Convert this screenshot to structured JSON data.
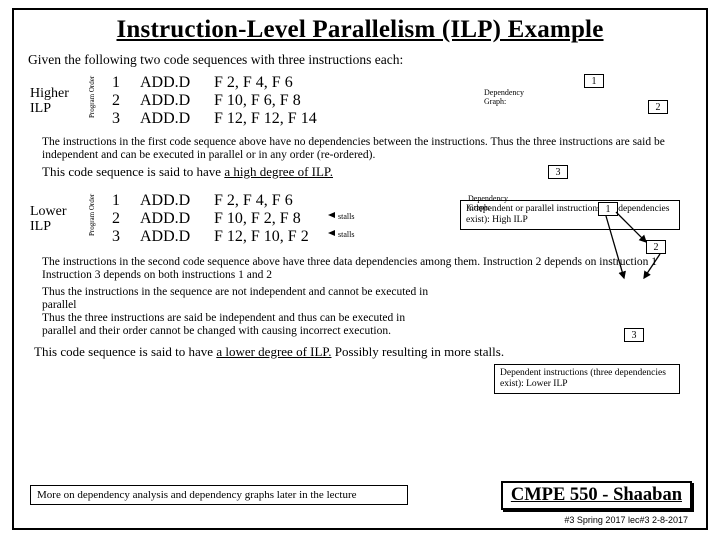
{
  "title": "Instruction-Level Parallelism (ILP) Example",
  "intro": "Given the following two code sequences with three instructions each:",
  "labels": {
    "higher": "Higher\nILP",
    "lower": "Lower\nILP",
    "program_order": "Program  Order",
    "dep_graph": "Dependency\nGraph:",
    "stalls": "stalls"
  },
  "nodes": {
    "n1": "1",
    "n2": "2",
    "n3": "3"
  },
  "seq1": {
    "r1": {
      "n": "1",
      "op": "ADD.D",
      "args": "F 2, F 4, F 6"
    },
    "r2": {
      "n": "2",
      "op": "ADD.D",
      "args": "F 10, F 6, F 8"
    },
    "r3": {
      "n": "3",
      "op": "ADD.D",
      "args": "F 12, F 12, F 14"
    }
  },
  "seq2": {
    "r1": {
      "n": "1",
      "op": "ADD.D",
      "args": "F 2, F 4, F 6"
    },
    "r2": {
      "n": "2",
      "op": "ADD.D",
      "args": "F 10, F 2, F 8"
    },
    "r3": {
      "n": "3",
      "op": "ADD.D",
      "args": "F 12, F 10, F 2"
    }
  },
  "para1": "The instructions in the first code sequence above have no dependencies  between the instructions. Thus the three instructions are said be independent and can be executed in parallel or in any order (re-ordered).",
  "hi1a": "This code sequence is said to have ",
  "hi1b": "a high degree of ILP.",
  "box1": "Independent or parallel instructions  (no dependencies exist):  High ILP",
  "para2": "The instructions in the second code sequence above have three data dependencies among them. Instruction 2 depends on instruction 1\nInstruction 3 depends on both  instructions  1 and 2",
  "para3": "Thus the instructions in the sequence are not independent and cannot be executed in parallel\nThus the three instructions are said be independent and thus can be executed in parallel and their order cannot be changed with causing incorrect execution.",
  "box2": "Dependent instructions (three dependencies exist):  Lower ILP",
  "hi2a": "This code sequence is said to have ",
  "hi2b": "a lower degree of ILP.",
  "hi2c": " Possibly resulting in more stalls.",
  "note": "More on dependency analysis and dependency graphs later in the lecture",
  "course": "CMPE 550 - Shaaban",
  "pagenum": "#3  Spring 2017   lec#3  2-8-2017"
}
